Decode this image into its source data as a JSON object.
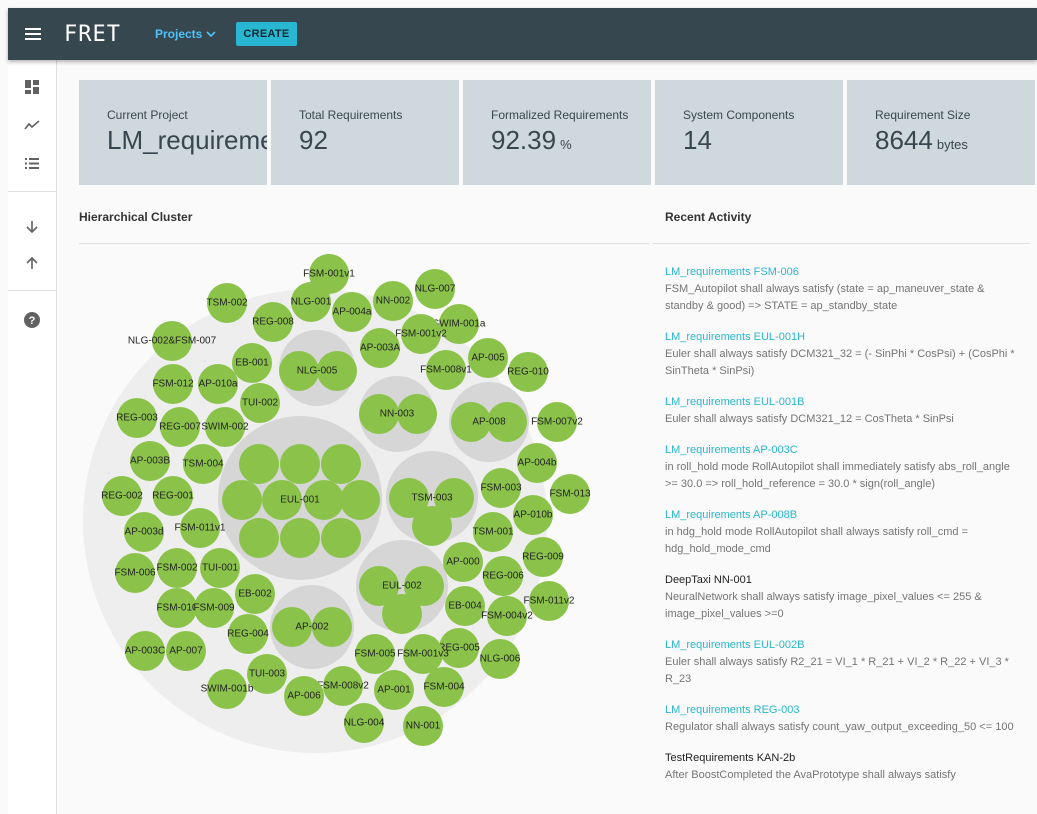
{
  "appbar": {
    "menu_icon": "menu-icon",
    "brand": "FRET",
    "projects_label": "Projects",
    "create_label": "CREATE"
  },
  "sidebar": {
    "icons": [
      "dashboard-icon",
      "trending-icon",
      "list-icon",
      "arrow-down-icon",
      "arrow-up-icon",
      "help-icon"
    ]
  },
  "cards": [
    {
      "label": "Current Project",
      "value": "LM_requirements",
      "unit": ""
    },
    {
      "label": "Total Requirements",
      "value": "92",
      "unit": ""
    },
    {
      "label": "Formalized Requirements",
      "value": "92.39",
      "unit": "%"
    },
    {
      "label": "System Components",
      "value": "14",
      "unit": ""
    },
    {
      "label": "Requirement Size",
      "value": "8644",
      "unit": "bytes"
    }
  ],
  "cluster": {
    "title": "Hierarchical Cluster",
    "colors": {
      "outer": "#eeeeee",
      "group": "#d6d6d6",
      "leaf": "#8bc34a"
    },
    "groups": [
      {
        "label": "EUL-001"
      },
      {
        "label": "NLG-005"
      },
      {
        "label": "NN-003"
      },
      {
        "label": "AP-008"
      },
      {
        "label": "TSM-003"
      },
      {
        "label": "EUL-002"
      },
      {
        "label": "AP-002"
      }
    ],
    "leaves": [
      "FSM-001v1",
      "NLG-007",
      "TSM-002",
      "NLG-001",
      "NN-002",
      "REG-008",
      "AP-004a",
      "SWIM-001a",
      "FSM-001v2",
      "AP-003A",
      "NLG-002&FSM-007",
      "EB-001",
      "AP-005",
      "FSM-008v1",
      "REG-010",
      "FSM-012",
      "AP-010a",
      "TUI-002",
      "REG-003",
      "REG-007",
      "SWIM-002",
      "FSM-007v2",
      "AP-003B",
      "TSM-004",
      "AP-004b",
      "REG-002",
      "REG-001",
      "FSM-003",
      "FSM-013",
      "AP-010b",
      "AP-003d",
      "FSM-011v1",
      "TSM-001",
      "REG-009",
      "FSM-006",
      "FSM-002",
      "TUI-001",
      "AP-000",
      "REG-006",
      "EB-002",
      "FSM-011v2",
      "FSM-010",
      "FSM-009",
      "EB-004",
      "FSM-004v2",
      "REG-004",
      "REG-005",
      "AP-003C",
      "AP-007",
      "FSM-005",
      "FSM-001v3",
      "NLG-006",
      "TUI-003",
      "FSM-008v2",
      "AP-001",
      "FSM-004",
      "SWIM-001b",
      "AP-006",
      "NLG-004",
      "NN-001"
    ]
  },
  "activity": {
    "title": "Recent Activity",
    "items": [
      {
        "title": "LM_requirements FSM-006",
        "text": "FSM_Autopilot shall always satisfy (state = ap_maneuver_state & standby & good) => STATE = ap_standby_state",
        "linked": true
      },
      {
        "title": "LM_requirements EUL-001H",
        "text": "Euler shall always satisfy DCM321_32 = (- SinPhi * CosPsi) + (CosPhi * SinTheta * SinPsi)",
        "linked": true
      },
      {
        "title": "LM_requirements EUL-001B",
        "text": "Euler shall always satisfy DCM321_12 = CosTheta * SinPsi",
        "linked": true
      },
      {
        "title": "LM_requirements AP-003C",
        "text": "in roll_hold mode RollAutopilot shall immediately satisfy abs_roll_angle >= 30.0 => roll_hold_reference = 30.0 * sign(roll_angle)",
        "linked": true
      },
      {
        "title": "LM_requirements AP-008B",
        "text": "in hdg_hold mode RollAutopilot shall always satisfy roll_cmd = hdg_hold_mode_cmd",
        "linked": true
      },
      {
        "title": "DeepTaxi NN-001",
        "text": "NeuralNetwork shall always satisfy image_pixel_values <= 255 & image_pixel_values >=0",
        "linked": false
      },
      {
        "title": "LM_requirements EUL-002B",
        "text": "Euler shall always satisfy R2_21 = VI_1 * R_21 + VI_2 * R_22 + VI_3 * R_23",
        "linked": true
      },
      {
        "title": "LM_requirements REG-003",
        "text": "Regulator shall always satisfy count_yaw_output_exceeding_50 <= 100",
        "linked": true
      },
      {
        "title": "TestRequirements KAN-2b",
        "text": "After BoostCompleted the AvaPrototype shall always satisfy",
        "linked": false
      }
    ]
  }
}
